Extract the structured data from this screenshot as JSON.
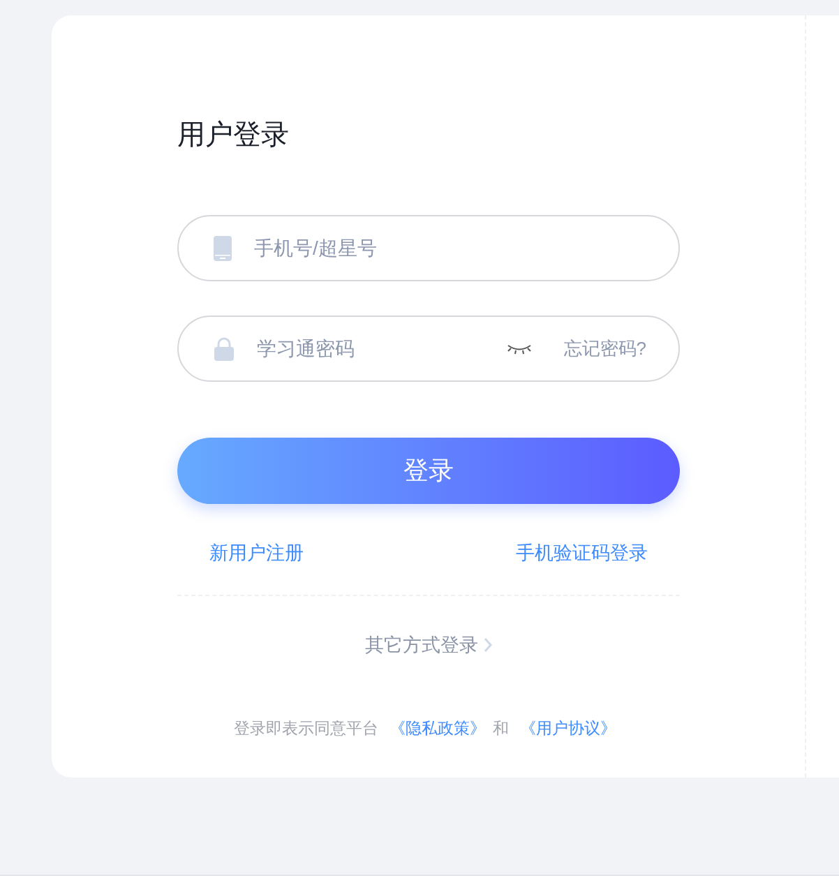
{
  "title": "用户登录",
  "fields": [
    {
      "kind": "phone",
      "placeholder": "手机号/超星号"
    },
    {
      "kind": "password",
      "placeholder": "学习通密码",
      "forgot_link": "忘记密码?"
    }
  ],
  "login_button": "登录",
  "links": [
    "新用户注册",
    "手机验证码登录"
  ],
  "other_login": "其它方式登录",
  "agreement": {
    "prefix": "登录即表示同意平台",
    "privacy": "《隐私政策》",
    "conjunction": "和",
    "terms": "《用户协议》"
  }
}
